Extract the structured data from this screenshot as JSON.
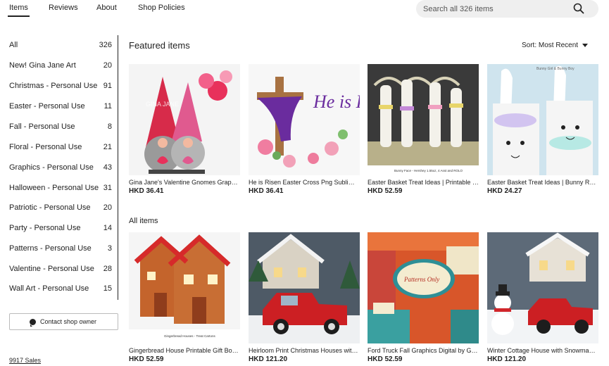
{
  "tabs": [
    {
      "label": "Items",
      "active": true
    },
    {
      "label": "Reviews"
    },
    {
      "label": "About"
    },
    {
      "label": "Shop Policies"
    }
  ],
  "search": {
    "placeholder": "Search all 326 items",
    "icon": "search-icon"
  },
  "sidebar": {
    "categories": [
      {
        "label": "All",
        "count": "326"
      },
      {
        "label": "New! Gina Jane Art",
        "count": "20"
      },
      {
        "label": "Christmas - Personal Use",
        "count": "91"
      },
      {
        "label": "Easter - Personal Use",
        "count": "11"
      },
      {
        "label": "Fall - Personal Use",
        "count": "8"
      },
      {
        "label": "Floral - Personal Use",
        "count": "21"
      },
      {
        "label": "Graphics - Personal Use",
        "count": "43"
      },
      {
        "label": "Halloween - Personal Use",
        "count": "31"
      },
      {
        "label": "Patriotic - Personal Use",
        "count": "20"
      },
      {
        "label": "Party - Personal Use",
        "count": "14"
      },
      {
        "label": "Patterns - Personal Use",
        "count": "3"
      },
      {
        "label": "Valentine - Personal Use",
        "count": "28"
      },
      {
        "label": "Wall Art - Personal Use",
        "count": "15"
      }
    ],
    "contact_label": "Contact shop owner",
    "sales_label": "9917 Sales"
  },
  "featured": {
    "title": "Featured items",
    "sort_label": "Sort: Most Recent",
    "items": [
      {
        "title": "Gina Jane's Valentine Gnomes Graphic...",
        "price": "HKD 36.41",
        "image_text": "GINA JANE"
      },
      {
        "title": "He is Risen Easter Cross Png Sublimati...",
        "price": "HKD 36.41",
        "image_text": "He is Rise"
      },
      {
        "title": "Easter Basket Treat Ideas | Printable Ca...",
        "price": "HKD 52.59",
        "image_text": "Bunny Face - Hershey 1.55oz, 4 Asst and ROLO"
      },
      {
        "title": "Easter Basket Treat Ideas | Bunny Rolo ...",
        "price": "HKD 24.27",
        "image_text": "Bunny Girl & Bunny Boy"
      }
    ]
  },
  "all_items": {
    "title": "All items",
    "items": [
      {
        "title": "Gingerbread House Printable Gift Box ...",
        "price": "HKD 52.59",
        "image_text": "Gingerbread Houses - Treat Cartons"
      },
      {
        "title": "Heirloom Print Christmas Houses with ...",
        "price": "HKD 121.20"
      },
      {
        "title": "Ford Truck Fall Graphics Digital by Gin...",
        "price": "HKD 52.59",
        "image_text": "Patterns Only"
      },
      {
        "title": "Winter Cottage House with Snowman ...",
        "price": "HKD 121.20"
      }
    ]
  }
}
